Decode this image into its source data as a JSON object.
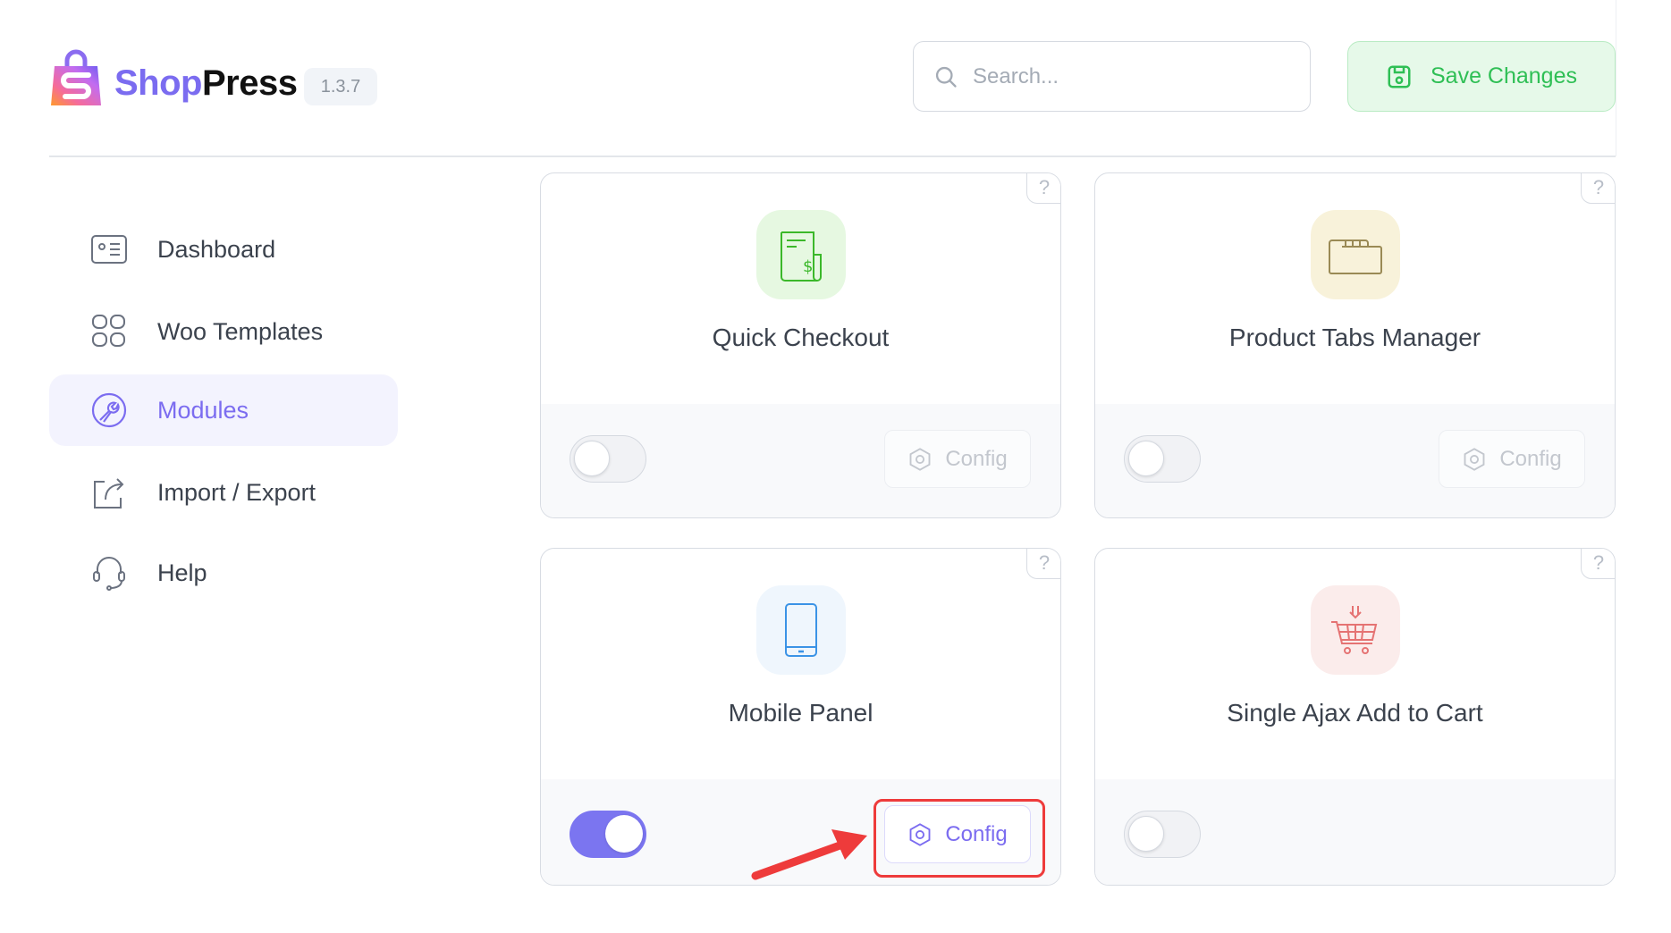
{
  "header": {
    "brand_part1": "Shop",
    "brand_part2": "Press",
    "version": "1.3.7",
    "search": {
      "placeholder": "Search...",
      "value": ""
    },
    "save_label": "Save Changes"
  },
  "sidebar": {
    "items": [
      {
        "label": "Dashboard",
        "icon": "dashboard-icon",
        "active": false
      },
      {
        "label": "Woo Templates",
        "icon": "grid-icon",
        "active": false
      },
      {
        "label": "Modules",
        "icon": "wrench-icon",
        "active": true
      },
      {
        "label": "Import / Export",
        "icon": "share-export-icon",
        "active": false
      },
      {
        "label": "Help",
        "icon": "headset-icon",
        "active": false
      }
    ]
  },
  "modules": [
    {
      "title": "Quick Checkout",
      "icon": "receipt-dollar-icon",
      "enabled": false,
      "config_label": "Config",
      "help": "?",
      "has_config": true
    },
    {
      "title": "Product Tabs Manager",
      "icon": "folder-tabs-icon",
      "enabled": false,
      "config_label": "Config",
      "help": "?",
      "has_config": true
    },
    {
      "title": "Mobile Panel",
      "icon": "mobile-phone-icon",
      "enabled": true,
      "config_label": "Config",
      "help": "?",
      "has_config": true
    },
    {
      "title": "Single Ajax Add to Cart",
      "icon": "cart-add-icon",
      "enabled": false,
      "help": "?",
      "has_config": false
    }
  ],
  "colors": {
    "accent": "#7b6cf0",
    "save_green": "#2fbf55",
    "annotation_red": "#ee3b3b"
  }
}
